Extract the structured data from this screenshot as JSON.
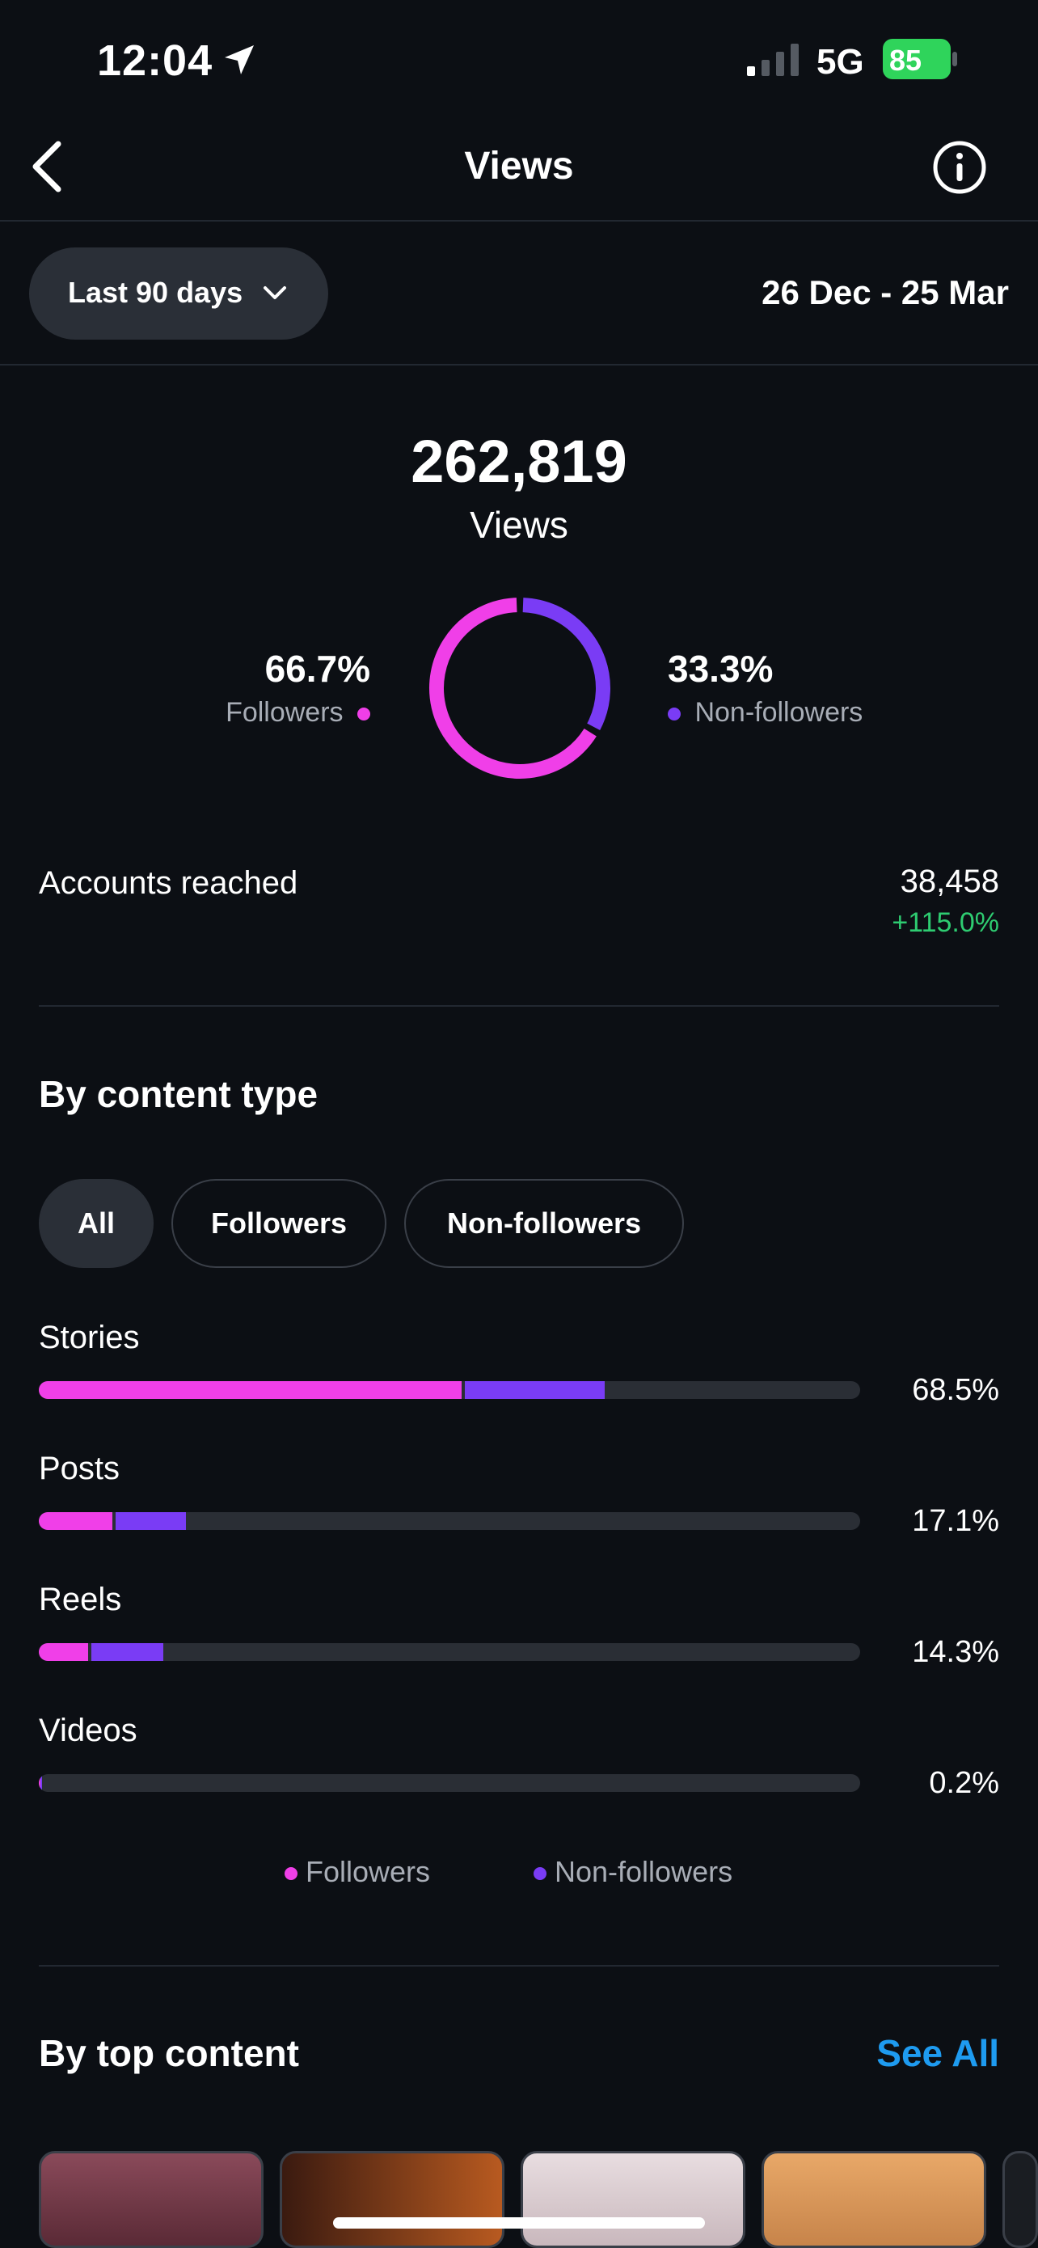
{
  "status_bar": {
    "time": "12:04",
    "network": "5G",
    "battery": "85"
  },
  "header": {
    "title": "Views"
  },
  "range": {
    "label": "Last 90 days",
    "dates": "26 Dec - 25 Mar"
  },
  "summary": {
    "total_views": "262,819",
    "total_label": "Views",
    "followers_pct": "66.7%",
    "followers_label": "Followers",
    "nonfollowers_pct": "33.3%",
    "nonfollowers_label": "Non-followers",
    "followers_share": 0.667
  },
  "accounts_reached": {
    "label": "Accounts reached",
    "value": "38,458",
    "change": "+115.0%"
  },
  "by_content_type": {
    "title": "By content type",
    "chips": [
      {
        "label": "All",
        "active": true
      },
      {
        "label": "Followers",
        "active": false
      },
      {
        "label": "Non-followers",
        "active": false
      }
    ],
    "rows": [
      {
        "label": "Stories",
        "pct": "68.5%",
        "followers_frac": 0.515,
        "nonfollowers_frac": 0.17
      },
      {
        "label": "Posts",
        "pct": "17.1%",
        "followers_frac": 0.09,
        "nonfollowers_frac": 0.085
      },
      {
        "label": "Reels",
        "pct": "14.3%",
        "followers_frac": 0.06,
        "nonfollowers_frac": 0.088
      },
      {
        "label": "Videos",
        "pct": "0.2%",
        "followers_frac": 0.002,
        "nonfollowers_frac": 0.002
      }
    ],
    "legend": {
      "followers": "Followers",
      "nonfollowers": "Non-followers"
    }
  },
  "by_top_content": {
    "title": "By top content",
    "see_all": "See All"
  },
  "colors": {
    "followers": "#f03fe8",
    "nonfollowers": "#7a3cf5",
    "positive": "#2ecc71",
    "link": "#1e9bf0"
  }
}
